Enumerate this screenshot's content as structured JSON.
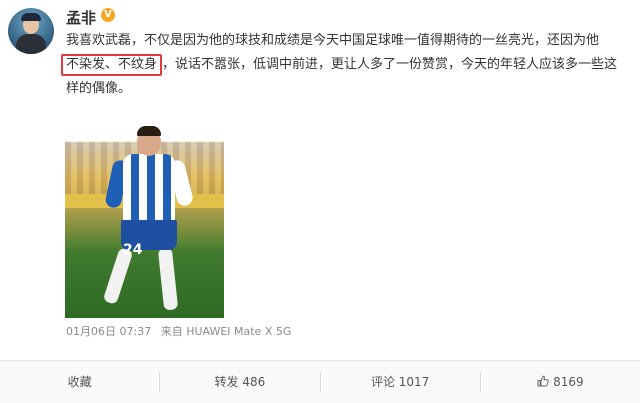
{
  "post": {
    "username": "孟非",
    "vip_badge": "V",
    "text_lines": {
      "line1": "我喜欢武磊，不仅是因为他的球技和成绩是今天中国足球唯一值得期待的一丝亮光，还因为他",
      "line2_highlight": "不染发、不纹身",
      "line2_rest": "，说话不嚣张，低调中前进，更让人多了一份赞赏，今天的年轻人应该多一些这",
      "line3": "样的偶像。"
    },
    "highlight_color": "#e0393e",
    "photo": {
      "jersey_number": "24",
      "jersey_colors": [
        "#1f5fb5",
        "#ffffff"
      ]
    },
    "meta": {
      "timestamp": "01月06日 07:37",
      "source": "来自 HUAWEI Mate X 5G"
    }
  },
  "actions": {
    "favorite": "收藏",
    "repost": "转发 486",
    "comment": "评论 1017",
    "like_count": "8169",
    "like_icon": "thumbs-up-icon"
  }
}
